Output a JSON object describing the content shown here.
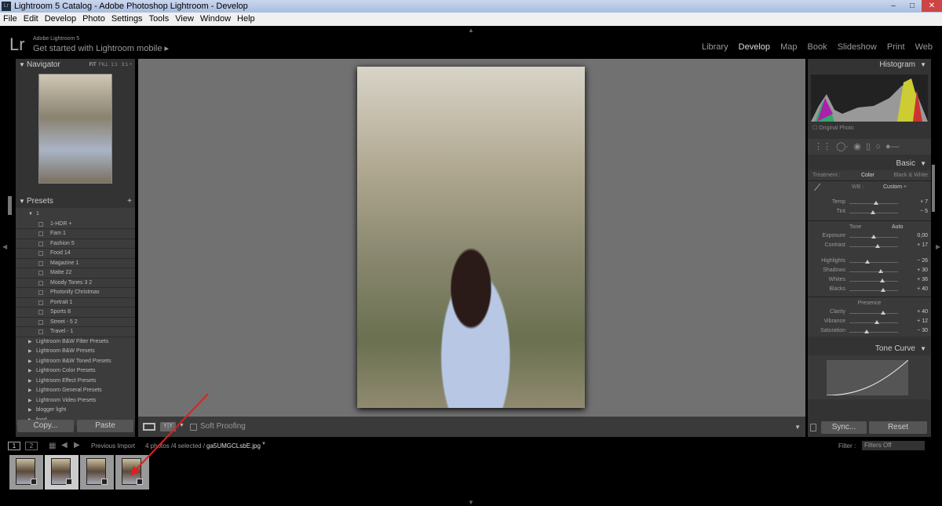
{
  "window": {
    "title": "Lightroom 5 Catalog - Adobe Photoshop Lightroom - Develop",
    "icon": "Lr"
  },
  "menu": [
    "File",
    "Edit",
    "Develop",
    "Photo",
    "Settings",
    "Tools",
    "View",
    "Window",
    "Help"
  ],
  "identity": {
    "logo": "Lr",
    "product": "Adobe Lightroom 5",
    "mobile": "Get started with Lightroom mobile ▸"
  },
  "modules": [
    {
      "label": "Library"
    },
    {
      "label": "Develop",
      "active": true
    },
    {
      "label": "Map"
    },
    {
      "label": "Book"
    },
    {
      "label": "Slideshow"
    },
    {
      "label": "Print"
    },
    {
      "label": "Web"
    }
  ],
  "navigator": {
    "title": "Navigator",
    "zoom": [
      "FIT",
      "FILL",
      "1:1",
      "3:1 ÷"
    ]
  },
  "presets": {
    "title": "Presets",
    "add": "+",
    "folder": "1",
    "items": [
      "1-HDR +",
      "Fam 1",
      "Fashion 5",
      "Food 14",
      "Magazine 1",
      "Matte 22",
      "Moody Tones 3 2",
      "Photonify Christmas",
      "Portrait 1",
      "Sports 8",
      "Street - 5 2",
      "Travel - 1"
    ],
    "folders": [
      "Lightroom B&W Filter Presets",
      "Lightroom B&W Presets",
      "Lightroom B&W Toned Presets",
      "Lightroom Color Presets",
      "Lightroom Effect Presets",
      "Lightroom General Presets",
      "Lightroom Video Presets",
      "blogger light",
      "food"
    ]
  },
  "left_buttons": {
    "copy": "Copy...",
    "paste": "Paste"
  },
  "toolbar": {
    "soft_proofing": "Soft Proofing"
  },
  "histogram": {
    "title": "Histogram",
    "original_photo": "Original Photo"
  },
  "basic": {
    "title": "Basic",
    "treatment_label": "Treatment :",
    "color": "Color",
    "bw": "Black & White",
    "wb_label": "WB :",
    "wb_value": "Custom ÷",
    "wb_sliders": [
      {
        "label": "Temp",
        "value": "+ 7",
        "pos": 0.55
      },
      {
        "label": "Tint",
        "value": "− 5",
        "pos": 0.48
      }
    ],
    "tone_label": "Tone",
    "auto": "Auto",
    "tone_sliders": [
      {
        "label": "Exposure",
        "value": "0,00",
        "pos": 0.5
      },
      {
        "label": "Contrast",
        "value": "+ 17",
        "pos": 0.58
      }
    ],
    "tone_sliders2": [
      {
        "label": "Highlights",
        "value": "− 26",
        "pos": 0.37
      },
      {
        "label": "Shadows",
        "value": "+ 30",
        "pos": 0.65
      },
      {
        "label": "Whites",
        "value": "+ 36",
        "pos": 0.68
      },
      {
        "label": "Blacks",
        "value": "+ 40",
        "pos": 0.7
      }
    ],
    "presence_label": "Presence",
    "presence_sliders": [
      {
        "label": "Clarity",
        "value": "+ 40",
        "pos": 0.7
      },
      {
        "label": "Vibrance",
        "value": "+ 12",
        "pos": 0.56
      },
      {
        "label": "Saturation",
        "value": "− 30",
        "pos": 0.35
      }
    ]
  },
  "tone_curve": {
    "title": "Tone Curve"
  },
  "right_buttons": {
    "sync": "Sync...",
    "reset": "Reset"
  },
  "filmstrip": {
    "page1": "1",
    "page2": "2",
    "source": "Previous Import",
    "info": "4 photos /4 selected /",
    "filename": "ga5UMGCLsbE.jpg",
    "filter_label": "Filter :",
    "filter_value": "Filters Off"
  },
  "colors": {
    "accent": "#cccccc",
    "panel": "#333333",
    "arrow": "#e02020"
  }
}
